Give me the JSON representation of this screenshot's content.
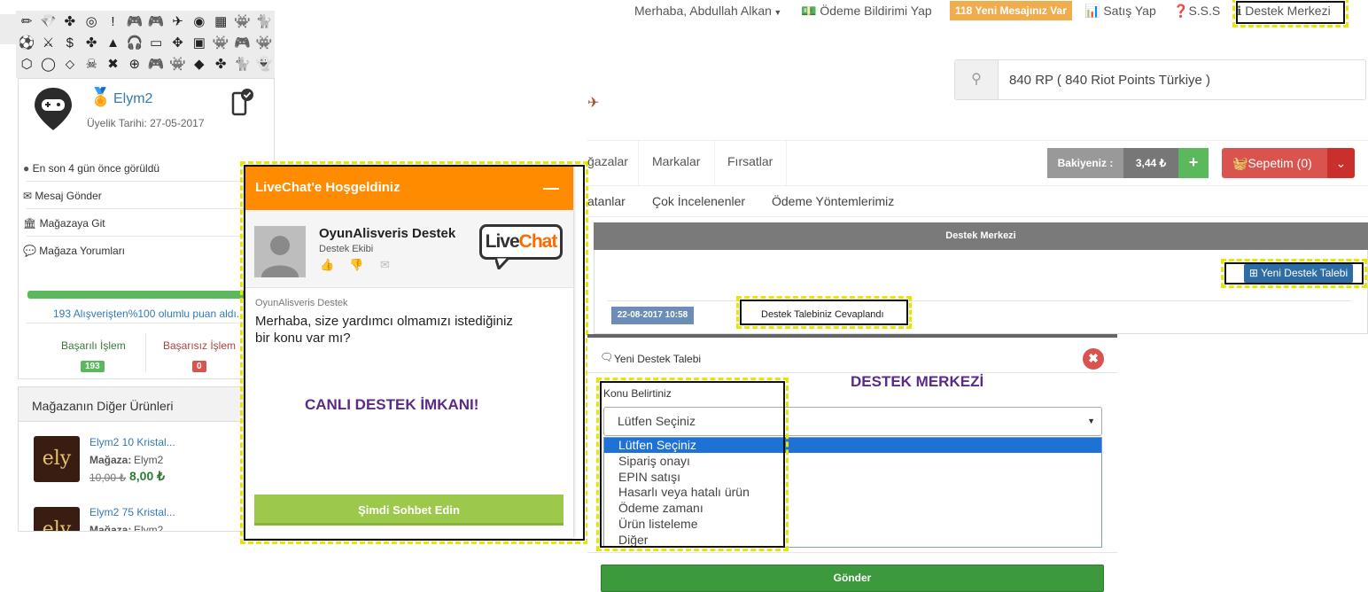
{
  "left": {
    "icons": [
      "✏",
      "💎",
      "✤",
      "◎",
      "!",
      "🎮",
      "🎮",
      "✈",
      "◉",
      "▦",
      "👾",
      "🐈",
      "⚽",
      "⚔",
      "$",
      "✤",
      "▲",
      "🎧",
      "▭",
      "✥",
      "▣",
      "👾",
      "🎮",
      "👾",
      "⬡",
      "◯",
      "⬦",
      "☠",
      "✖",
      "⊕",
      "🎮",
      "👾",
      "◆",
      "✤",
      "🐈",
      "👻"
    ],
    "store_name": "Elym2",
    "member_since": "Üyelik Tarihi: 27-05-2017",
    "last_seen": "En son 4 gün önce görüldü",
    "send_message": "Mesaj Gönder",
    "go_store": "Mağazaya Git",
    "store_reviews": "Mağaza Yorumları",
    "rating_text": "193 Alışverişten%100 olumlu puan aldı.",
    "rating_percent": 100,
    "success_label": "Başarılı İşlem",
    "success_count": "193",
    "fail_label": "Başarısız İşlem",
    "fail_count": "0",
    "other_products_title": "Mağazanın Diğer Ürünleri",
    "products": [
      {
        "name": "Elym2 10 Kristal...",
        "store_label": "Mağaza:",
        "store": "Elym2",
        "old_price": "10,00 ₺",
        "price": "8,00 ₺"
      },
      {
        "name": "Elym2 75 Kristal...",
        "store_label": "Mağaza:",
        "store": "Elym2"
      }
    ]
  },
  "livechat": {
    "header": "LiveChat'e Hoşgeldiniz",
    "minimize": "—",
    "agent_name": "OyunAlisveris Destek",
    "agent_role": "Destek Ekibi",
    "logo_text": "LiveChat",
    "sender": "OyunAlisveris Destek",
    "message": "Merhaba, size yardımcı olmamızı istediğiniz bir konu var mı?",
    "cta": "Şimdi Sohbet Edin"
  },
  "annotations": {
    "live_support": "CANLI DESTEK İMKANI!",
    "support_center": "DESTEK MERKEZİ"
  },
  "topbar": {
    "greeting": "Merhaba, Abdullah Alkan",
    "payment_notice": "Ödeme Bildirimi Yap",
    "messages_badge": "118 Yeni Mesajınız Var",
    "sell": "Satış Yap",
    "faq": "S.S.S",
    "support_center": "Destek Merkezi"
  },
  "search": {
    "value": "840 RP ( 840 Riot Points Türkiye )"
  },
  "nav": {
    "items": [
      "ğazalar",
      "Markalar",
      "Fırsatlar"
    ],
    "balance_label": "Bakiyeniz :",
    "balance_value": "3,44 ₺",
    "cart": "Sepetim (0)",
    "sub": [
      "atanlar",
      "Çok İncelenenler",
      "Ödeme Yöntemlerimiz"
    ]
  },
  "support": {
    "title": "Destek Merkezi",
    "new_ticket": "⊞ Yeni Destek Talebi",
    "ticket_date": "22-08-2017 10:58",
    "ticket_status": "Destek Talebiniz Cevaplandı"
  },
  "modal": {
    "title": "Yeni Destek Talebi",
    "topic_label": "Konu Belirtiniz",
    "selected": "Lütfen Seçiniz",
    "options": [
      "Lütfen Seçiniz",
      "Sipariş onayı",
      "EPIN satışı",
      "Hasarlı veya hatalı ürün",
      "Ödeme zamanı",
      "Ürün listeleme",
      "Diğer"
    ],
    "submit": "Gönder"
  },
  "colors": {
    "orange": "#ff8c00",
    "green": "#5cb85c",
    "red": "#d9534f",
    "annotation": "#5b2a86",
    "highlight": "#e6e600"
  }
}
